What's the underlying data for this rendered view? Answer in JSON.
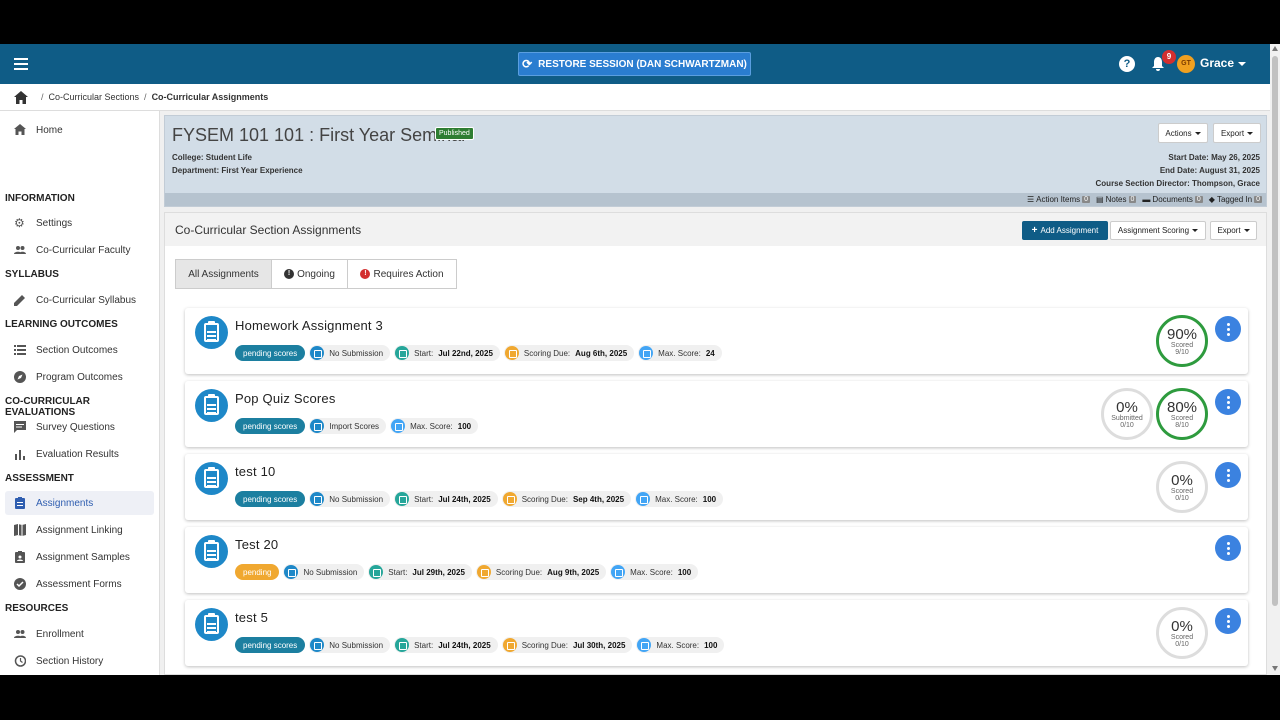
{
  "topbar": {
    "restore_label": "RESTORE SESSION (DAN SCHWARTZMAN)",
    "notification_count": "9",
    "avatar_initials": "GT",
    "user_name": "Grace"
  },
  "breadcrumb": [
    "Co-Curricular Sections",
    "Co-Curricular Assignments"
  ],
  "sidebar": {
    "home": "Home",
    "sections": [
      {
        "heading": "INFORMATION",
        "items": [
          "Settings",
          "Co-Curricular Faculty"
        ]
      },
      {
        "heading": "SYLLABUS",
        "items": [
          "Co-Curricular Syllabus"
        ]
      },
      {
        "heading": "LEARNING OUTCOMES",
        "items": [
          "Section Outcomes",
          "Program Outcomes"
        ]
      },
      {
        "heading": "CO-CURRICULAR EVALUATIONS",
        "items": [
          "Survey Questions",
          "Evaluation Results"
        ]
      },
      {
        "heading": "ASSESSMENT",
        "items": [
          "Assignments",
          "Assignment Linking",
          "Assignment Samples",
          "Assessment Forms"
        ]
      },
      {
        "heading": "RESOURCES",
        "items": [
          "Enrollment",
          "Section History"
        ]
      }
    ],
    "active_item": "Assignments"
  },
  "course": {
    "title": "FYSEM 101 101 : First Year Seminar",
    "badge": "Published",
    "college": "College: Student Life",
    "department": "Department: First Year Experience",
    "start_date": "Start Date: May 26, 2025",
    "end_date": "End Date: August 31, 2025",
    "director": "Course Section Director: Thompson, Grace",
    "actions_label": "Actions",
    "export_label": "Export",
    "strip": [
      {
        "label": "Action Items",
        "count": "0"
      },
      {
        "label": "Notes",
        "count": "0"
      },
      {
        "label": "Documents",
        "count": "0"
      },
      {
        "label": "Tagged In",
        "count": "0"
      }
    ]
  },
  "section": {
    "title": "Co-Curricular Section Assignments",
    "add_label": "Add Assignment",
    "scoring_label": "Assignment Scoring",
    "export_label": "Export",
    "tabs": [
      "All Assignments",
      "Ongoing",
      "Requires Action"
    ]
  },
  "assignments": [
    {
      "title": "Homework Assignment 3",
      "status": "pending scores",
      "submission": "No Submission",
      "start_label": "Start:",
      "start": "Jul 22nd, 2025",
      "due_label": "Scoring Due:",
      "due": "Aug 6th, 2025",
      "max_label": "Max. Score:",
      "max": "24",
      "rings": [
        {
          "pct": "90%",
          "label": "Scored",
          "frac": "9/10",
          "progress": 0.9
        }
      ]
    },
    {
      "title": "Pop Quiz Scores",
      "status": "pending scores",
      "submission": "Import Scores",
      "max_label": "Max. Score:",
      "max": "100",
      "rings": [
        {
          "pct": "0%",
          "label": "Submitted",
          "frac": "0/10",
          "progress": 0
        },
        {
          "pct": "80%",
          "label": "Scored",
          "frac": "8/10",
          "progress": 0.8
        }
      ]
    },
    {
      "title": "test 10",
      "status": "pending scores",
      "submission": "No Submission",
      "start_label": "Start:",
      "start": "Jul 24th, 2025",
      "due_label": "Scoring Due:",
      "due": "Sep 4th, 2025",
      "max_label": "Max. Score:",
      "max": "100",
      "rings": [
        {
          "pct": "0%",
          "label": "Scored",
          "frac": "0/10",
          "progress": 0
        }
      ]
    },
    {
      "title": "Test 20",
      "status": "pending",
      "submission": "No Submission",
      "start_label": "Start:",
      "start": "Jul 29th, 2025",
      "due_label": "Scoring Due:",
      "due": "Aug 9th, 2025",
      "max_label": "Max. Score:",
      "max": "100",
      "rings": []
    },
    {
      "title": "test 5",
      "status": "pending scores",
      "submission": "No Submission",
      "start_label": "Start:",
      "start": "Jul 24th, 2025",
      "due_label": "Scoring Due:",
      "due": "Jul 30th, 2025",
      "max_label": "Max. Score:",
      "max": "100",
      "rings": [
        {
          "pct": "0%",
          "label": "Scored",
          "frac": "0/10",
          "progress": 0
        }
      ]
    }
  ],
  "colors": {
    "topbar": "#0f5c86",
    "status_pending_scores": "#1c7fa0",
    "status_pending": "#f0a830",
    "submission_icon": "#1e88c8",
    "start_icon": "#26a69a",
    "due_icon": "#f0a830",
    "max_icon": "#42a5f5",
    "ring_complete": "#2e9b3e"
  }
}
